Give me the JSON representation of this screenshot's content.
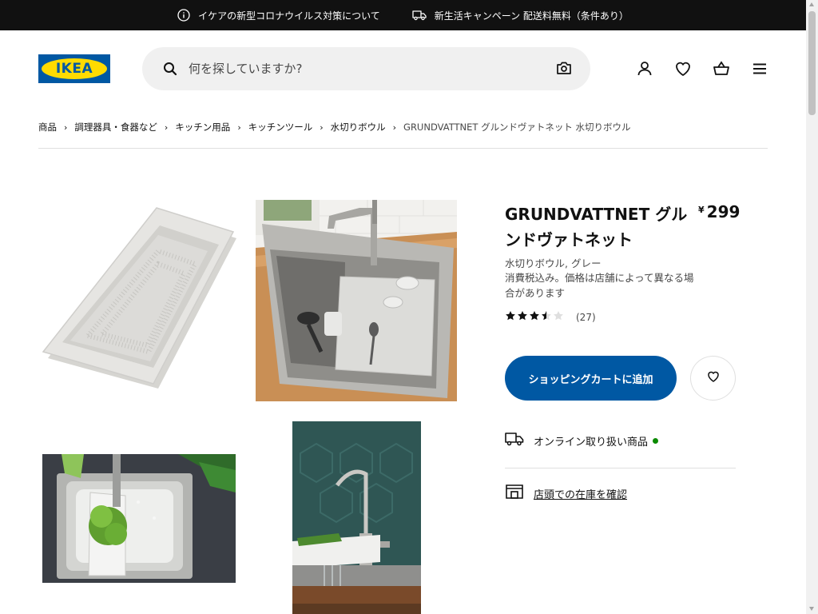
{
  "topbar": {
    "notice1": "イケアの新型コロナウイルス対策について",
    "notice1_icon": "info-icon",
    "notice2": "新生活キャンペーン 配送料無料（条件あり）",
    "notice2_icon": "truck-icon"
  },
  "header": {
    "logo_text": "IKEA",
    "search_placeholder": "何を探していますか?",
    "icons": [
      "search-icon",
      "camera-icon",
      "user-icon",
      "heart-icon",
      "cart-icon",
      "menu-icon"
    ]
  },
  "breadcrumb": {
    "items": [
      "商品",
      "調理器具・食器など",
      "キッチン用品",
      "キッチンツール",
      "水切りボウル"
    ],
    "separator": "›",
    "current": "GRUNDVATTNET グルンドヴァトネット 水切りボウル"
  },
  "product": {
    "name": "GRUNDVATTNET グルンドヴァトネット",
    "currency": "¥",
    "price": "299",
    "type": "水切りボウル, グレー",
    "tax_note": "消費税込み。価格は店舗によって異なる場合があります",
    "rating": 3.5,
    "rating_max": 5,
    "review_count": "(27)",
    "add_to_cart": "ショッピングカートに追加",
    "online_label": "オンライン取り扱い商品",
    "store_label": "店頭での在庫を確認"
  },
  "colors": {
    "brand_blue": "#0058a3",
    "brand_yellow": "#ffdb00",
    "topbar_bg": "#111111",
    "online_dot": "#0a8a00"
  }
}
